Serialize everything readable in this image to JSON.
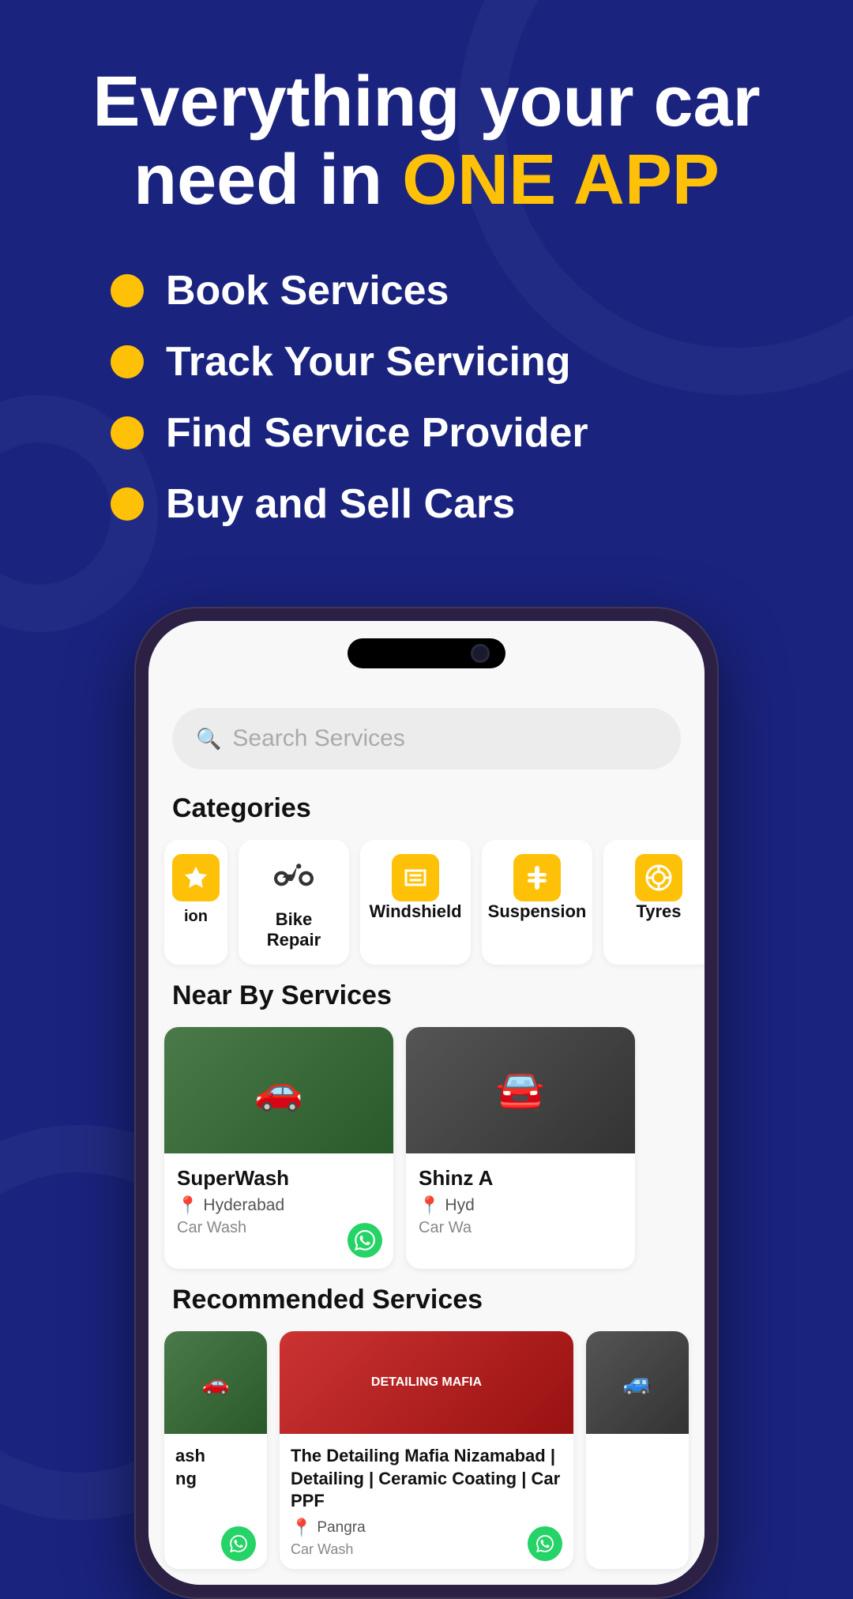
{
  "hero": {
    "title_line1": "Everything your car",
    "title_line2": "need in ",
    "title_highlight": "ONE APP",
    "features": [
      {
        "id": "book",
        "label": "Book Services"
      },
      {
        "id": "track",
        "label": "Track Your Servicing"
      },
      {
        "id": "find",
        "label": "Find Service Provider"
      },
      {
        "id": "buy",
        "label": "Buy and Sell Cars"
      }
    ]
  },
  "phone": {
    "search": {
      "placeholder": "Search Services"
    },
    "categories": {
      "title": "Categories",
      "items": [
        {
          "id": "partial",
          "label": "ion",
          "icon": "⚙️",
          "type": "partial"
        },
        {
          "id": "bike-repair",
          "label": "Bike Repair",
          "icon": "⚙️",
          "type": "gear"
        },
        {
          "id": "windshield",
          "label": "Windshield",
          "icon": "🔧",
          "type": "yellow"
        },
        {
          "id": "suspension",
          "label": "Suspension",
          "icon": "🔩",
          "type": "yellow"
        },
        {
          "id": "tyres",
          "label": "Tyres",
          "icon": "⭕",
          "type": "yellow"
        }
      ]
    },
    "nearby": {
      "title": "Near By Services",
      "items": [
        {
          "id": "superwash",
          "name": "SuperWash",
          "location": "Hyderabad",
          "type": "Car Wash",
          "imgType": "wash"
        },
        {
          "id": "shinz",
          "name": "Shinz A",
          "location": "Hyd",
          "type": "Car Wa",
          "imgType": "car"
        }
      ]
    },
    "recommended": {
      "title": "Recommended Services",
      "items": [
        {
          "id": "partial-ash",
          "name": "ash\nng",
          "imgType": "partial"
        },
        {
          "id": "detailing-mafia",
          "name": "The Detailing Mafia Nizamabad | Detailing | Ceramic Coating | Car PPF",
          "location": "Pangra",
          "type": "Car Wash",
          "imgType": "detailing"
        },
        {
          "id": "third",
          "name": "",
          "imgType": "car"
        }
      ]
    }
  },
  "colors": {
    "dark_blue": "#1a237e",
    "yellow": "#FFC107",
    "white": "#ffffff",
    "whatsapp_green": "#25D366"
  }
}
